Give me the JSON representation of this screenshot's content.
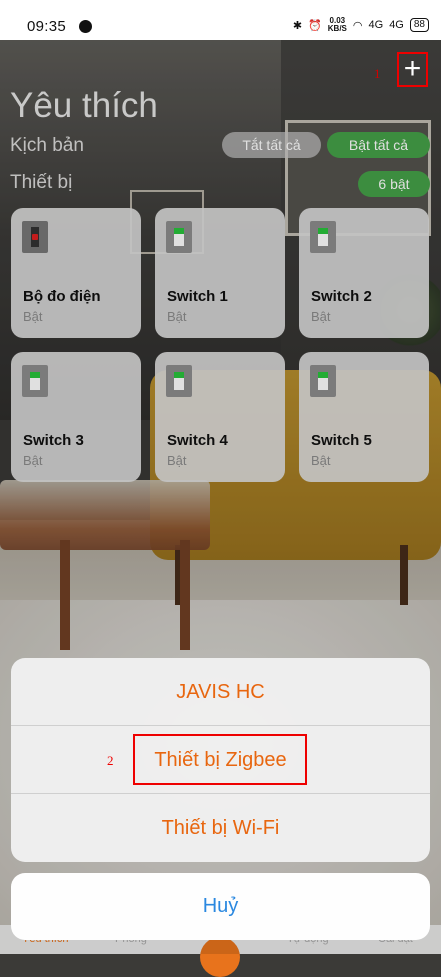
{
  "status_bar": {
    "time": "09:35",
    "net_speed_top": "0.03",
    "net_speed_bottom": "KB/S",
    "signal_1": "4G",
    "signal_2": "4G",
    "battery": "88"
  },
  "header": {
    "add_label": "+",
    "annotation_1": "1",
    "title": "Yêu thích",
    "scenes_label": "Kịch bản",
    "devices_label": "Thiết bị",
    "all_off_label": "Tắt tất cả",
    "all_on_label": "Bật tất cả",
    "on_count_label": "6 bật"
  },
  "devices": [
    {
      "name": "Bộ đo điện",
      "state": "Bật",
      "icon": "power-meter-icon"
    },
    {
      "name": "Switch 1",
      "state": "Bật",
      "icon": "switch-icon"
    },
    {
      "name": "Switch 2",
      "state": "Bật",
      "icon": "switch-icon"
    },
    {
      "name": "Switch 3",
      "state": "Bật",
      "icon": "switch-icon"
    },
    {
      "name": "Switch 4",
      "state": "Bật",
      "icon": "switch-icon"
    },
    {
      "name": "Switch 5",
      "state": "Bật",
      "icon": "switch-icon"
    }
  ],
  "bottom_nav": {
    "items": [
      "Yêu thích",
      "Phòng",
      "Tự động",
      "Cài đặt"
    ]
  },
  "action_sheet": {
    "options": [
      "JAVIS HC",
      "Thiết bị Zigbee",
      "Thiết bị Wi-Fi"
    ],
    "annotation_2": "2",
    "cancel_label": "Huỷ"
  },
  "colors": {
    "accent_orange": "#e8660f",
    "on_green": "#45a148",
    "cancel_blue": "#2a88e0",
    "annotation_red": "#ee0000"
  }
}
